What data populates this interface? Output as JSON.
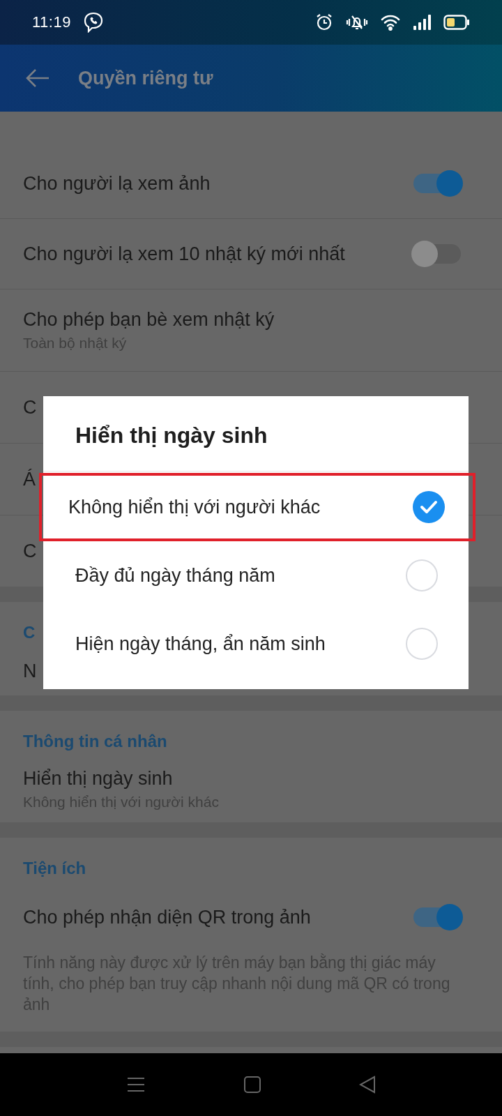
{
  "status_bar": {
    "time": "11:19"
  },
  "app_bar": {
    "title": "Quyền riêng tư"
  },
  "sections": [
    {
      "items": [
        {
          "kind": "toggle",
          "label": "Cho người lạ xem ảnh",
          "on": true
        },
        {
          "kind": "toggle",
          "label": "Cho người lạ xem 10 nhật ký mới nhất",
          "on": false
        },
        {
          "kind": "value",
          "label": "Cho phép bạn bè xem nhật ký",
          "value": "Toàn bộ nhật ký"
        },
        {
          "kind": "plain",
          "label": "C"
        },
        {
          "kind": "plain",
          "label": "Á"
        },
        {
          "kind": "plain",
          "label": "C"
        }
      ]
    },
    {
      "header": "C",
      "items": [
        {
          "kind": "plain",
          "label": "N"
        }
      ]
    },
    {
      "header": "Thông tin cá nhân",
      "items": [
        {
          "kind": "value",
          "label": "Hiển thị ngày sinh",
          "value": "Không hiển thị với người khác"
        }
      ]
    },
    {
      "header": "Tiện ích",
      "items": [
        {
          "kind": "toggle",
          "label": "Cho phép nhận diện QR trong ảnh",
          "on": true,
          "description": "Tính năng này được xử lý trên máy bạn bằng thị giác máy tính, cho phép bạn truy cập nhanh nội dung mã QR có trong ảnh"
        }
      ]
    }
  ],
  "dialog": {
    "title": "Hiển thị ngày sinh",
    "options": [
      {
        "label": "Không hiển thị với người khác",
        "selected": true,
        "highlighted": true
      },
      {
        "label": "Đầy đủ ngày tháng năm",
        "selected": false,
        "highlighted": false
      },
      {
        "label": "Hiện ngày tháng, ẩn năm sinh",
        "selected": false,
        "highlighted": false
      }
    ]
  }
}
